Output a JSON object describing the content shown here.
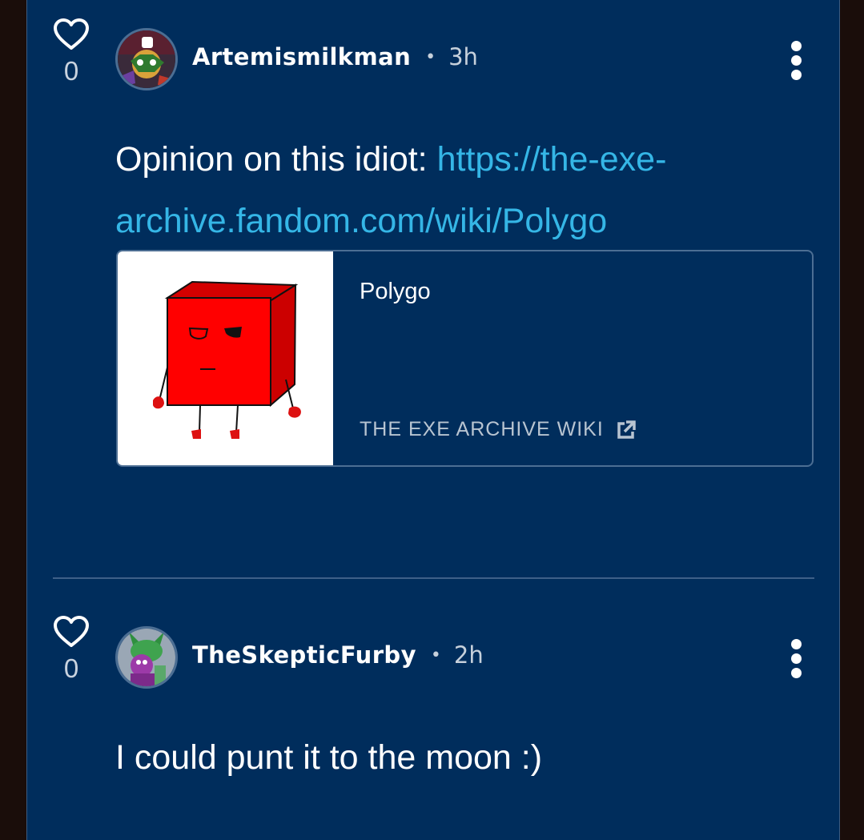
{
  "comments": [
    {
      "votes": "0",
      "author": "Artemismilkman",
      "separator": "•",
      "time": "3h",
      "text_prefix": "Opinion on this idiot: ",
      "link_text": "https://the-exe-archive.fandom.com/wiki/Polygo",
      "preview": {
        "title": "Polygo",
        "site": "THE EXE ARCHIVE WIKI"
      }
    },
    {
      "votes": "0",
      "author": "TheSkepticFurby",
      "separator": "•",
      "time": "2h",
      "text": "I could punt it to the moon :)"
    }
  ],
  "icons": {
    "like": "heart-outline-icon",
    "menu": "kebab-menu-icon",
    "external": "external-link-icon"
  },
  "colors": {
    "background": "#002d5c",
    "link": "#35b6e6",
    "text": "#ffffff",
    "muted": "#c6d0db"
  }
}
